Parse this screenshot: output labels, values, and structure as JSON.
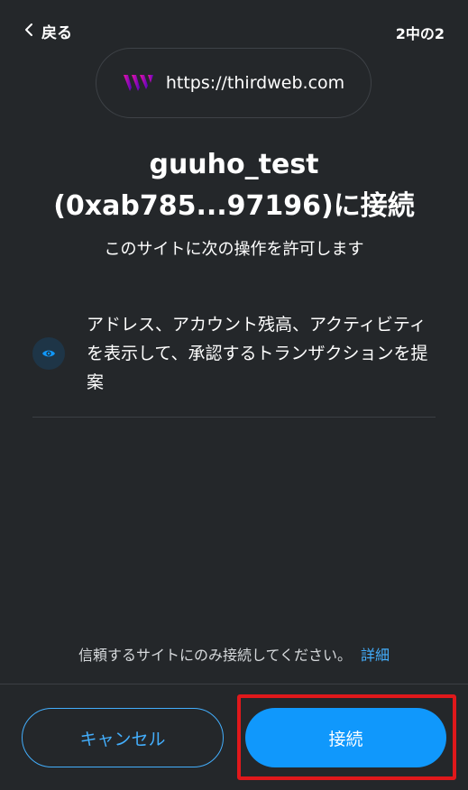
{
  "header": {
    "back_label": "戻る",
    "step_indicator": "2中の2"
  },
  "origin": {
    "logo_icon": "thirdweb-logo-icon",
    "url": "https://thirdweb.com"
  },
  "connect": {
    "title_line1": "guuho_test",
    "title_line2": "(0xab785...97196)に接続",
    "subtitle": "このサイトに次の操作を許可します"
  },
  "permissions": [
    {
      "icon": "eye-icon",
      "text": "アドレス、アカウント残高、アクティビティを表示して、承認するトランザクションを提案"
    }
  ],
  "footer": {
    "trust_note": "信頼するサイトにのみ接続してください。",
    "learn_more": "詳細",
    "cancel_label": "キャンセル",
    "connect_label": "接続"
  },
  "colors": {
    "background": "#24272a",
    "accent": "#1098fc",
    "link": "#43aefc",
    "highlight": "#e0181b"
  }
}
